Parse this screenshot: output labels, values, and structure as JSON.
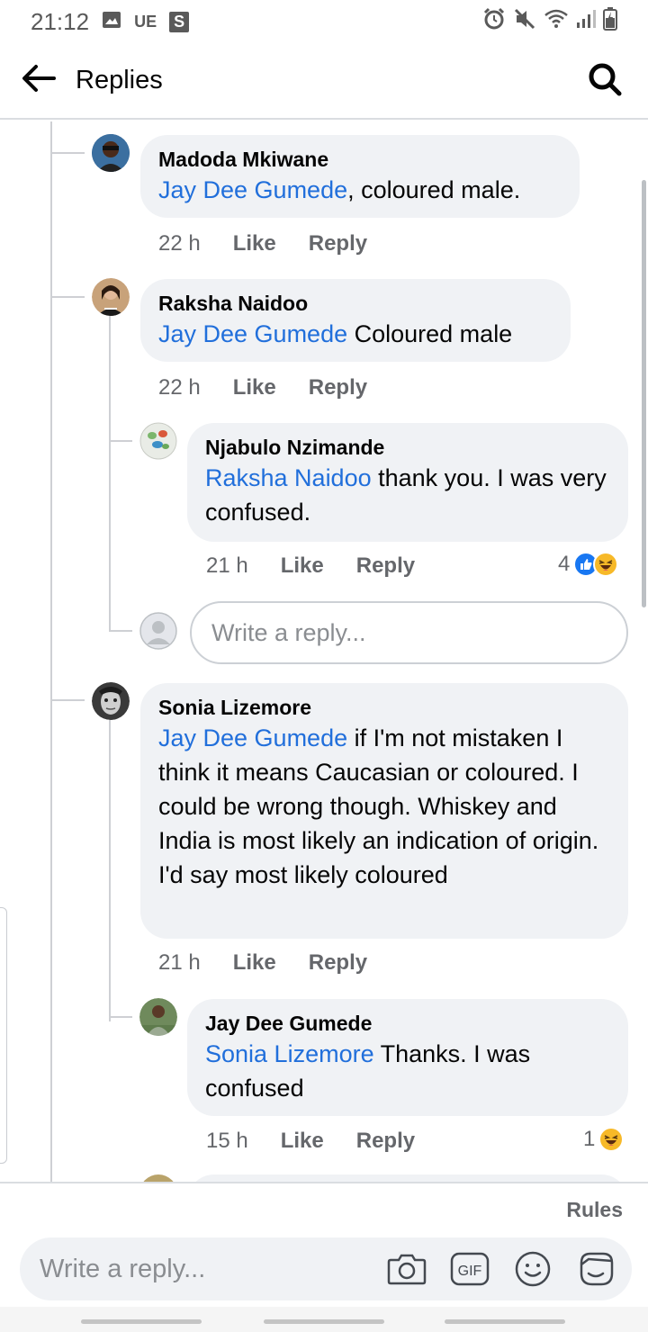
{
  "status_bar": {
    "time": "21:12",
    "carrier": "UE",
    "s_badge": "S",
    "icons": [
      "image-icon",
      "alarm-icon",
      "mute-icon",
      "wifi-icon",
      "signal-icon",
      "battery-icon"
    ]
  },
  "header": {
    "title": "Replies",
    "icons": [
      "back-arrow-icon",
      "search-icon"
    ]
  },
  "comments": [
    {
      "author": "Madoda Mkiwane",
      "mention": "Jay Dee Gumede",
      "text": ", coloured male.",
      "time": "22 h",
      "like": "Like",
      "reply": "Reply"
    },
    {
      "author": "Raksha Naidoo",
      "mention": "Jay Dee Gumede",
      "text": " Coloured male",
      "time": "22 h",
      "like": "Like",
      "reply": "Reply"
    },
    {
      "author": "Njabulo Nzimande",
      "mention": "Raksha Naidoo",
      "text": " thank you. I was very confused.",
      "time": "21 h",
      "like": "Like",
      "reply": "Reply",
      "reaction_count": "4",
      "reactions": [
        "like-reaction-icon",
        "haha-reaction-icon"
      ]
    },
    {
      "author": "Sonia Lizemore",
      "mention": "Jay Dee Gumede",
      "text": " if I'm not mistaken I think it means Caucasian or coloured. I could be wrong though. Whiskey and India is most likely an indication of origin. I'd say most likely coloured",
      "time": "21 h",
      "like": "Like",
      "reply": "Reply"
    },
    {
      "author": "Jay Dee Gumede",
      "mention": "Sonia Lizemore",
      "text": " Thanks. I was confused",
      "time": "15 h",
      "like": "Like",
      "reply": "Reply",
      "reaction_count": "1",
      "reactions": [
        "haha-reaction-icon"
      ]
    }
  ],
  "inline_reply": {
    "placeholder": "Write a reply..."
  },
  "composer": {
    "rules": "Rules",
    "placeholder": "Write a reply...",
    "icons": [
      "camera-icon",
      "gif-icon",
      "emoji-icon",
      "sticker-icon"
    ],
    "gif_label": "GIF"
  },
  "colors": {
    "mention": "#216fdb",
    "bubble": "#f0f2f5",
    "like_blue": "#1877f2",
    "haha_yellow": "#f7b928"
  }
}
